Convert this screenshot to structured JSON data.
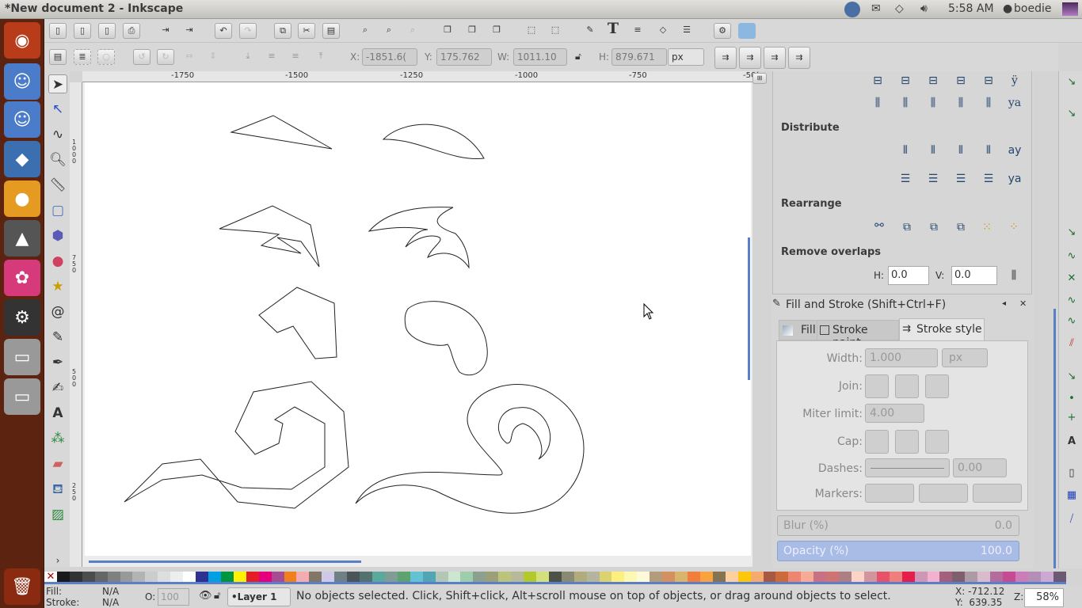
{
  "window": {
    "title": "*New document 2 - Inkscape"
  },
  "indicators": {
    "time": "5:58 AM",
    "user": "boedie",
    "icons": [
      "wolf-app-icon",
      "mail-icon",
      "wifi-icon",
      "volume-icon",
      "user-icon",
      "session-icon"
    ]
  },
  "launcher": {
    "items": [
      "ubuntu-dash",
      "finder",
      "finder",
      "wolf",
      "browser",
      "ink",
      "flower",
      "settings",
      "drive",
      "drive"
    ],
    "trash": "trash-icon"
  },
  "toolbar2": {
    "x_label": "X:",
    "x": "-1851.6(",
    "y_label": "Y:",
    "y": "175.762",
    "w_label": "W:",
    "w": "1011.10",
    "h_label": "H:",
    "h": "879.671",
    "unit": "px"
  },
  "ruler": {
    "ticks": [
      "-1750",
      "-1500",
      "-1250",
      "-1000",
      "-750",
      "-50("
    ]
  },
  "vruler": {
    "ticks": [
      "1000",
      "750",
      "500",
      "250"
    ]
  },
  "panel": {
    "distribute": "Distribute",
    "rearrange": "Rearrange",
    "remove_overlaps": "Remove overlaps",
    "h_label": "H:",
    "h": "0.0",
    "v_label": "V:",
    "v": "0.0",
    "fs_title": "Fill and Stroke (Shift+Ctrl+F)",
    "tabs": [
      "Fill",
      "Stroke paint",
      "Stroke style"
    ],
    "width_label": "Width:",
    "width": "1.000",
    "width_unit": "px",
    "join_label": "Join:",
    "miter_label": "Miter limit:",
    "miter": "4.00",
    "cap_label": "Cap:",
    "dashes_label": "Dashes:",
    "dash_offset": "0.00",
    "markers_label": "Markers:",
    "blur_label": "Blur (%)",
    "blur": "0.0",
    "opacity_label": "Opacity (%)",
    "opacity": "100.0"
  },
  "palette": [
    "#ffffff00",
    "#1a1a1a",
    "#333333",
    "#4d4d4d",
    "#666666",
    "#808080",
    "#999999",
    "#b3b3b3",
    "#cccccc",
    "#dedede",
    "#eeeeee",
    "#ffffff",
    "#2e3192",
    "#00a0e3",
    "#00963f",
    "#fff200",
    "#e31e24",
    "#e6007e",
    "#a54c93",
    "#f07f1e",
    "#f4acb0",
    "#827669",
    "#cdc9e6",
    "#6f7f85",
    "#4b5557",
    "#52716f",
    "#5ba89c",
    "#7f9d94",
    "#5fa271",
    "#63c2d3",
    "#52a6b4",
    "#b3c7b7",
    "#cde6d2",
    "#9dcdab",
    "#8ba08f",
    "#9ba07b",
    "#bbc478",
    "#b6ba9a",
    "#b3c82a",
    "#d3e07c",
    "#4d5147",
    "#8a8a74",
    "#b1ab7d",
    "#b5b49d",
    "#dbd36f",
    "#fdf07f",
    "#fef8b4",
    "#fefad9",
    "#b39c7b",
    "#d4915f",
    "#dab46c",
    "#f27e3e",
    "#f9a23e",
    "#857351",
    "#fdd09e",
    "#fdc80a",
    "#f6ab6d",
    "#a75a43",
    "#cd6a3a",
    "#ee8570",
    "#f6ab96",
    "#c97184",
    "#d07373",
    "#ad7e83",
    "#fbd3c7",
    "#d2959d",
    "#e85269",
    "#ee7f7c",
    "#e51e4b",
    "#cf97b6",
    "#f3b1d0",
    "#a45f7d",
    "#7f5f6d",
    "#ae9aa4",
    "#d8bccb",
    "#b26d9c",
    "#c54b93",
    "#cc7db8",
    "#b48fb5",
    "#cca9d3",
    "#6c5a74"
  ],
  "status": {
    "fill_label": "Fill:",
    "fill": "N/A",
    "stroke_label": "Stroke:",
    "stroke": "N/A",
    "o_label": "O:",
    "o": "100",
    "layer": "•Layer 1",
    "message": "No objects selected. Click, Shift+click, Alt+scroll mouse on top of objects, or drag around objects to select.",
    "cx": "X: -712.12",
    "cy": "Y:  639.35",
    "z_label": "Z:",
    "zoom": "58%"
  }
}
